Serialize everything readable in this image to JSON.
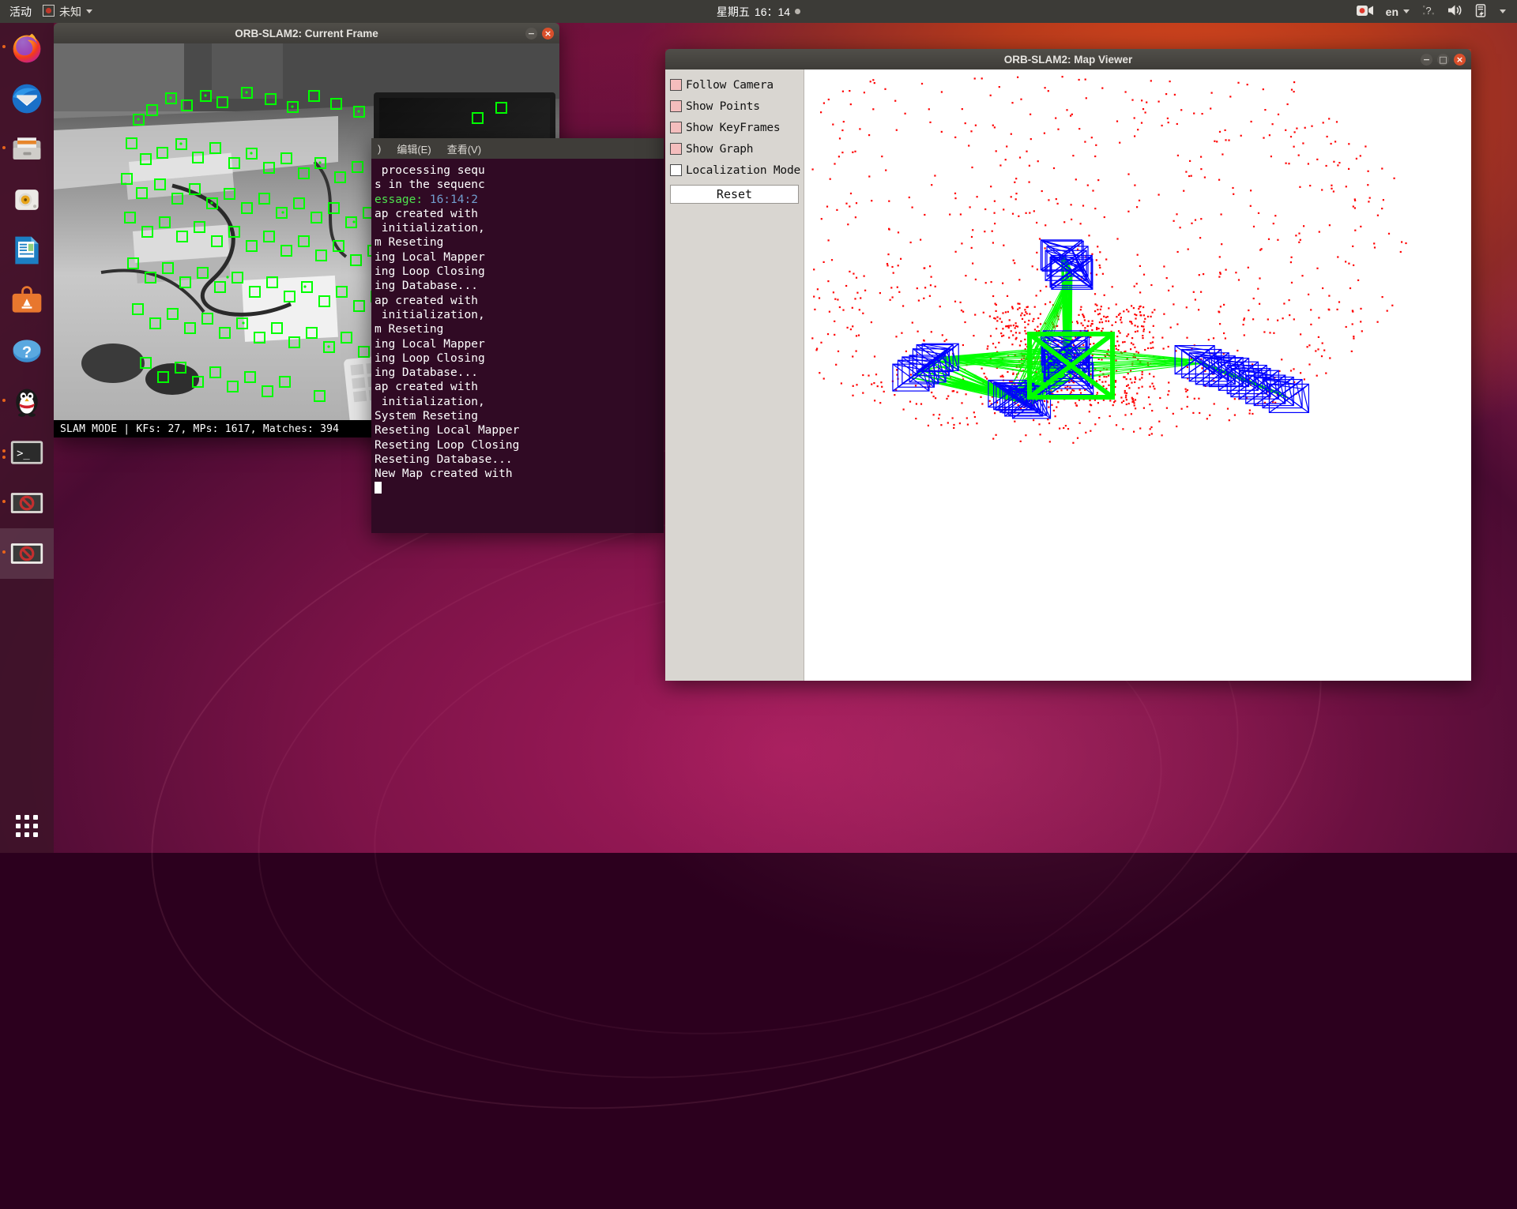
{
  "topbar": {
    "activities": "活动",
    "app_menu": {
      "label": "未知",
      "icon": "unknown-app-icon"
    },
    "clock": {
      "weekday": "星期五",
      "time": "16：14",
      "indicator": "recording-dot"
    },
    "indicators": [
      {
        "name": "screen-recording-icon",
        "label": ""
      },
      {
        "name": "keyboard-layout-indicator",
        "label": "en"
      },
      {
        "name": "help-icon",
        "label": "?"
      },
      {
        "name": "volume-icon",
        "label": ""
      },
      {
        "name": "battery-icon",
        "label": ""
      },
      {
        "name": "system-menu-caret",
        "label": ""
      }
    ]
  },
  "dock": {
    "items": [
      {
        "name": "firefox",
        "running": true,
        "active": false
      },
      {
        "name": "thunderbird",
        "running": false,
        "active": false
      },
      {
        "name": "files",
        "running": true,
        "active": false
      },
      {
        "name": "rhythmbox",
        "running": false,
        "active": false
      },
      {
        "name": "libreoffice-writer",
        "running": false,
        "active": false
      },
      {
        "name": "ubuntu-software",
        "running": false,
        "active": false
      },
      {
        "name": "help",
        "running": false,
        "active": false
      },
      {
        "name": "qq",
        "running": true,
        "active": false
      },
      {
        "name": "terminal",
        "running": true,
        "active": false
      },
      {
        "name": "orb-slam-frame-window",
        "running": true,
        "active": false
      },
      {
        "name": "orb-slam-map-window",
        "running": true,
        "active": true
      }
    ],
    "show_applications": "show-applications-grid"
  },
  "frame_window": {
    "title": "ORB-SLAM2: Current Frame",
    "controls": {
      "minimize": "−",
      "close": "×"
    },
    "status": "SLAM MODE |  KFs: 27, MPs: 1617, Matches: 394",
    "stats": {
      "mode": "SLAM MODE",
      "kfs": 27,
      "mps": 1617,
      "matches": 394
    },
    "features_color": "#00ff00",
    "image_description": "grayscale desk scene with monitor, keyboard, books and cables, overlaid with green ORB feature squares"
  },
  "terminal_window": {
    "menu": [
      {
        "name": "file-menu",
        "label": ")"
      },
      {
        "name": "edit-menu",
        "label": "编辑(E)"
      },
      {
        "name": "view-menu",
        "label": "查看(V)"
      }
    ],
    "lines": [
      {
        "text": " processing sequ",
        "color": "white"
      },
      {
        "text": "s in the sequenc",
        "color": "white"
      },
      {
        "text": "",
        "color": "white"
      },
      {
        "text": "essage:",
        "color": "green",
        "suffix": " 16:14:2",
        "suffix_color": "blue"
      },
      {
        "text": "ap created with",
        "color": "white"
      },
      {
        "text": " initialization,",
        "color": "white"
      },
      {
        "text": "m Reseting",
        "color": "white"
      },
      {
        "text": "ing Local Mapper",
        "color": "white"
      },
      {
        "text": "ing Loop Closing",
        "color": "white"
      },
      {
        "text": "ing Database...",
        "color": "white"
      },
      {
        "text": "ap created with",
        "color": "white"
      },
      {
        "text": " initialization,",
        "color": "white"
      },
      {
        "text": "m Reseting",
        "color": "white"
      },
      {
        "text": "ing Local Mapper",
        "color": "white"
      },
      {
        "text": "ing Loop Closing",
        "color": "white"
      },
      {
        "text": "ing Database...",
        "color": "white"
      },
      {
        "text": "ap created with",
        "color": "white"
      },
      {
        "text": " initialization,",
        "color": "white"
      },
      {
        "text": "System Reseting",
        "color": "white"
      },
      {
        "text": "Reseting Local Mapper",
        "color": "white"
      },
      {
        "text": "Reseting Loop Closing",
        "color": "white"
      },
      {
        "text": "Reseting Database...",
        "color": "white"
      },
      {
        "text": "New Map created with",
        "color": "white"
      }
    ],
    "cursor": "block-cursor"
  },
  "map_window": {
    "title": "ORB-SLAM2: Map Viewer",
    "controls": {
      "minimize": "−",
      "maximize": "□",
      "close": "×"
    },
    "checkbox_fill": "#f4bdbd",
    "checkboxes": [
      {
        "name": "follow-camera",
        "label": "Follow Camera",
        "checked": true
      },
      {
        "name": "show-points",
        "label": "Show Points",
        "checked": true
      },
      {
        "name": "show-keyframes",
        "label": "Show KeyFrames",
        "checked": true
      },
      {
        "name": "show-graph",
        "label": "Show Graph",
        "checked": true
      },
      {
        "name": "localization-mode",
        "label": "Localization Mode",
        "checked": false
      }
    ],
    "reset_button": "Reset",
    "viewport": {
      "background": "#ffffff",
      "map_point_color": "#ff0000",
      "keyframe_color": "#0000ff",
      "graph_edge_color": "#00ff00",
      "current_camera_color": "#00ff00"
    }
  }
}
